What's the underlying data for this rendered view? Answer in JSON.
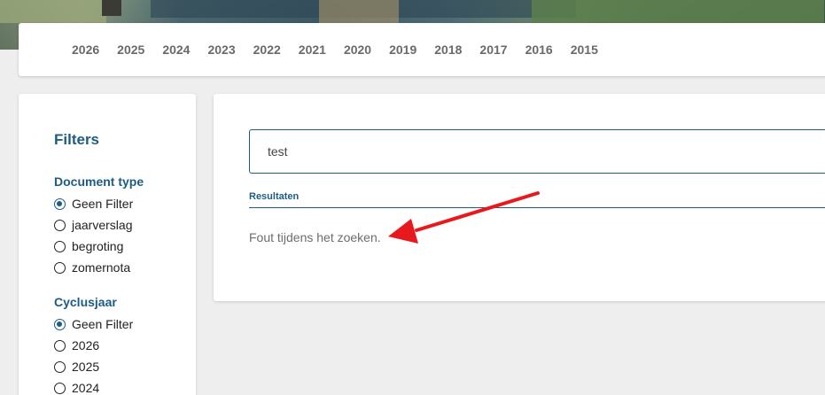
{
  "years": [
    "2026",
    "2025",
    "2024",
    "2023",
    "2022",
    "2021",
    "2020",
    "2019",
    "2018",
    "2017",
    "2016",
    "2015"
  ],
  "filters": {
    "title": "Filters",
    "document_type": {
      "label": "Document type",
      "options": [
        "Geen Filter",
        "jaarverslag",
        "begroting",
        "zomernota"
      ],
      "selected_index": 0
    },
    "cyclusjaar": {
      "label": "Cyclusjaar",
      "options": [
        "Geen Filter",
        "2026",
        "2025",
        "2024"
      ],
      "selected_index": 0
    }
  },
  "search": {
    "value": "test"
  },
  "results": {
    "label": "Resultaten",
    "message": "Fout tijdens het zoeken."
  },
  "colors": {
    "accent": "#1d5c82",
    "annotation_arrow": "#e8191c"
  },
  "icons": {
    "radio_checked": "radio-checked-icon",
    "radio_unchecked": "radio-unchecked-icon",
    "annotation": "red-arrow-icon"
  }
}
